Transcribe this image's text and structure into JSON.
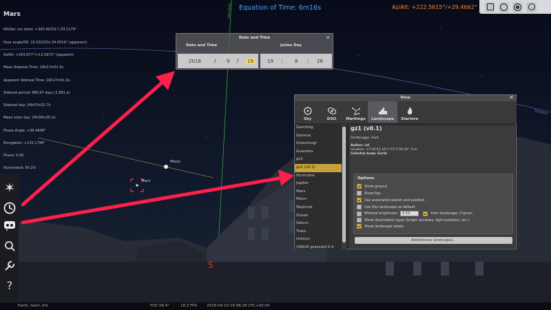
{
  "object_info": {
    "name": "Mars",
    "lines": [
      "RA/Dec (on date): +305.49331°/-24.1176°",
      "Hour angle/DE: 22.93232h/-24.0519° (apparent)",
      "Az/Alt: +164.977°/+13.5973° (apparent)",
      "Mean Sidereal Time: 19h17m52.5s",
      "Apparent Sidereal Time: 19h17m51.6s",
      "Sidereal period: 686.97 days (1.881 a)",
      "Sidereal day: 24h37m22.7s",
      "Mean solar day: 24h39m35.2s",
      "Phase Angle: +36.4608°",
      "Elongation: +125.1798°",
      "Phase: 0.90",
      "Illuminated: 90.2%"
    ]
  },
  "equation_of_time": "Equation of Time: 6m16s",
  "az_alt": "Az/Alt: +222.5615°/+29.4662°",
  "sky_labels": {
    "meridian": "Meridian",
    "equator": "Equator",
    "moon": "Moon",
    "mars": "Mars",
    "cardinal_south": "S"
  },
  "date_time_dialog": {
    "title": "Date and Time",
    "date_time_label": "Date and Time",
    "julian_day_label": "Julian Day",
    "year": "2018",
    "month": "9",
    "day": "19",
    "hour": "19",
    "minute": "8",
    "second": "28"
  },
  "view_dialog": {
    "title": "View",
    "tabs": [
      {
        "label": "Sky",
        "icon": "sky-icon"
      },
      {
        "label": "DSO",
        "icon": "galaxy-icon"
      },
      {
        "label": "Markings",
        "icon": "markings-icon"
      },
      {
        "label": "Landscape",
        "icon": "landscape-icon"
      },
      {
        "label": "Starlore",
        "icon": "flame-icon"
      }
    ],
    "active_tab": "Landscape",
    "landscapes": [
      "Garching",
      "Geneva",
      "Grossmugl",
      "Guereins",
      "gz1",
      "gz1 (v0.1)",
      "Hurricane",
      "Jupiter",
      "Mars",
      "Moon",
      "Neptune",
      "Ocean",
      "Saturn",
      "Trees",
      "Uranus",
      "VSRU0 grasveld 0.4"
    ],
    "selected": "gz1 (v0.1)",
    "detail": {
      "name": "gz1 (v0.1)",
      "subtitle": "Gentbrugge, Gent",
      "author": "Author: ad",
      "location": "Location: +3°42'41.16\"/+51°1'59.34\", 8 m",
      "planet": "Celestial body: Earth"
    },
    "options_title": "Options",
    "options": [
      {
        "label": "Show ground",
        "checked": true
      },
      {
        "label": "Show fog",
        "checked": false
      },
      {
        "label": "Use associated planet and position",
        "checked": true
      },
      {
        "label": "Use this landscape as default",
        "checked": false
      },
      {
        "label": "Minimal brightness:",
        "checked": false,
        "value": "0.10",
        "extra": "from landscape, if given"
      },
      {
        "label": "Show illumination layer (bright windows, light pollution, etc.)",
        "checked": false
      },
      {
        "label": "Show landscape labels",
        "checked": true
      }
    ],
    "add_remove_button": "Add/remove landscapes..."
  },
  "status_bar": {
    "location": "Earth, Gent, 0m",
    "fov": "FOV 58.4°",
    "fps": "18.3 FPS",
    "datetime": "2018-09-19   19:08:28 UTC+00:00"
  },
  "colors": {
    "annotation_arrow": "#ff1f4c",
    "equation_text": "#4aa3ff",
    "azalt_text": "#ff8a1e",
    "selection": "#c8a238"
  }
}
